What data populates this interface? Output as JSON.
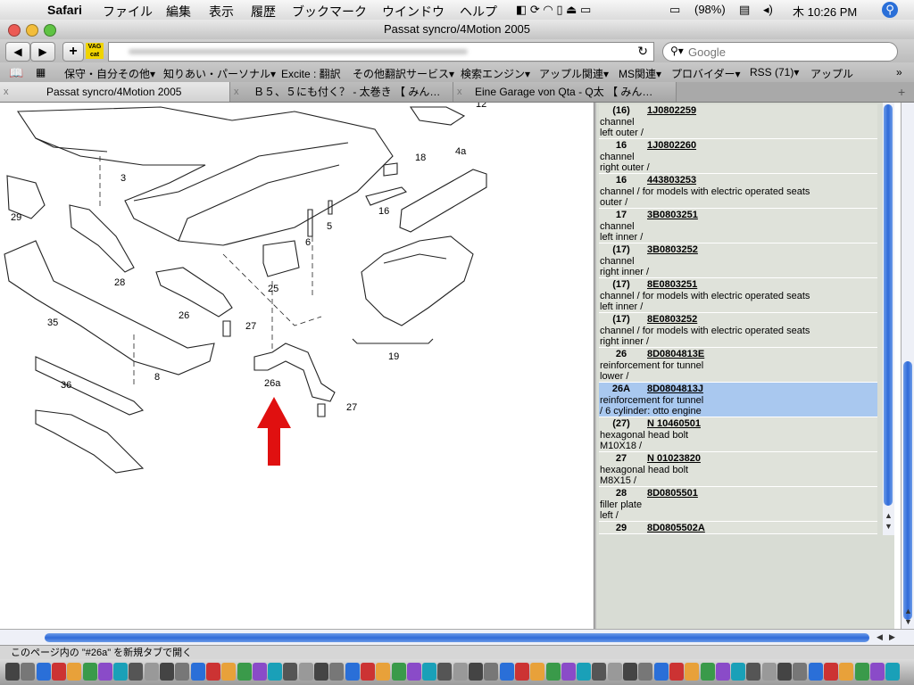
{
  "menubar": {
    "app": "Safari",
    "items": [
      "ファイル",
      "編集",
      "表示",
      "履歴",
      "ブックマーク",
      "ウインドウ",
      "ヘルプ"
    ],
    "battery": "(98%)",
    "clock": "木 10:26 PM"
  },
  "window": {
    "title": "Passat syncro/4Motion 2005"
  },
  "toolbar": {
    "back": "◀",
    "forward": "▶",
    "add": "+",
    "vag_line1": "VAG",
    "vag_line2": "cat",
    "reload": "↻",
    "search_placeholder": "Google"
  },
  "bookmarks": [
    "保守・自分その他▾",
    "知りあい・パーソナル▾",
    "Excite : 翻訳",
    "その他翻訳サービス▾",
    "検索エンジン▾",
    "アップル関連▾",
    "MS関連▾",
    "プロバイダー▾",
    "RSS (71)▾",
    "アップル"
  ],
  "tabs": [
    {
      "label": "Passat syncro/4Motion 2005",
      "active": true
    },
    {
      "label": "Ｂ５、５にも付く？ - 太巻き 【 みん…",
      "active": false
    },
    {
      "label": "Eine Garage von Qta - Q太 【 みん…",
      "active": false
    }
  ],
  "tab_close": "x",
  "tab_add": "+",
  "diagram": {
    "callouts": [
      "3",
      "29",
      "28",
      "26",
      "25",
      "6",
      "5",
      "16",
      "18",
      "4a",
      "35",
      "27",
      "8",
      "36",
      "26a",
      "27",
      "19",
      "12"
    ]
  },
  "parts": [
    {
      "num": "(16)",
      "pn": "1J0802259",
      "d1": "channel",
      "d2": "left outer /",
      "sel": false
    },
    {
      "num": "16",
      "pn": "1J0802260",
      "d1": "channel",
      "d2": "right outer /",
      "sel": false
    },
    {
      "num": "16",
      "pn": "443803253",
      "d1": "channel / for models with electric operated seats",
      "d2": "outer /",
      "sel": false
    },
    {
      "num": "17",
      "pn": "3B0803251",
      "d1": "channel",
      "d2": "left inner /",
      "sel": false
    },
    {
      "num": "(17)",
      "pn": "3B0803252",
      "d1": "channel",
      "d2": "right inner /",
      "sel": false
    },
    {
      "num": "(17)",
      "pn": "8E0803251",
      "d1": "channel / for models with electric operated seats",
      "d2": "left inner /",
      "sel": false
    },
    {
      "num": "(17)",
      "pn": "8E0803252",
      "d1": "channel / for models with electric operated seats",
      "d2": "right inner /",
      "sel": false
    },
    {
      "num": "26",
      "pn": "8D0804813E",
      "d1": "reinforcement for tunnel",
      "d2": "lower /",
      "sel": false
    },
    {
      "num": "26A",
      "pn": "8D0804813J",
      "d1": "reinforcement for tunnel",
      "d2": "/ 6 cylinder: otto engine",
      "sel": true
    },
    {
      "num": "(27)",
      "pn": "N 10460501",
      "d1": "hexagonal head bolt",
      "d2": "M10X18 /",
      "sel": false
    },
    {
      "num": "27",
      "pn": "N 01023820",
      "d1": "hexagonal head bolt",
      "d2": "M8X15 /",
      "sel": false
    },
    {
      "num": "28",
      "pn": "8D0805501",
      "d1": "filler plate",
      "d2": "left /",
      "sel": false
    },
    {
      "num": "29",
      "pn": "8D0805502A",
      "d1": "",
      "d2": "",
      "sel": false
    }
  ],
  "status": {
    "text": "このページ内の \"#26a\" を新規タブで開く"
  },
  "colors": {
    "selected_row": "#a9c8ef",
    "row": "#dfe2da",
    "arrow": "#e01010",
    "scroll_thumb": "#2f6ad8"
  }
}
